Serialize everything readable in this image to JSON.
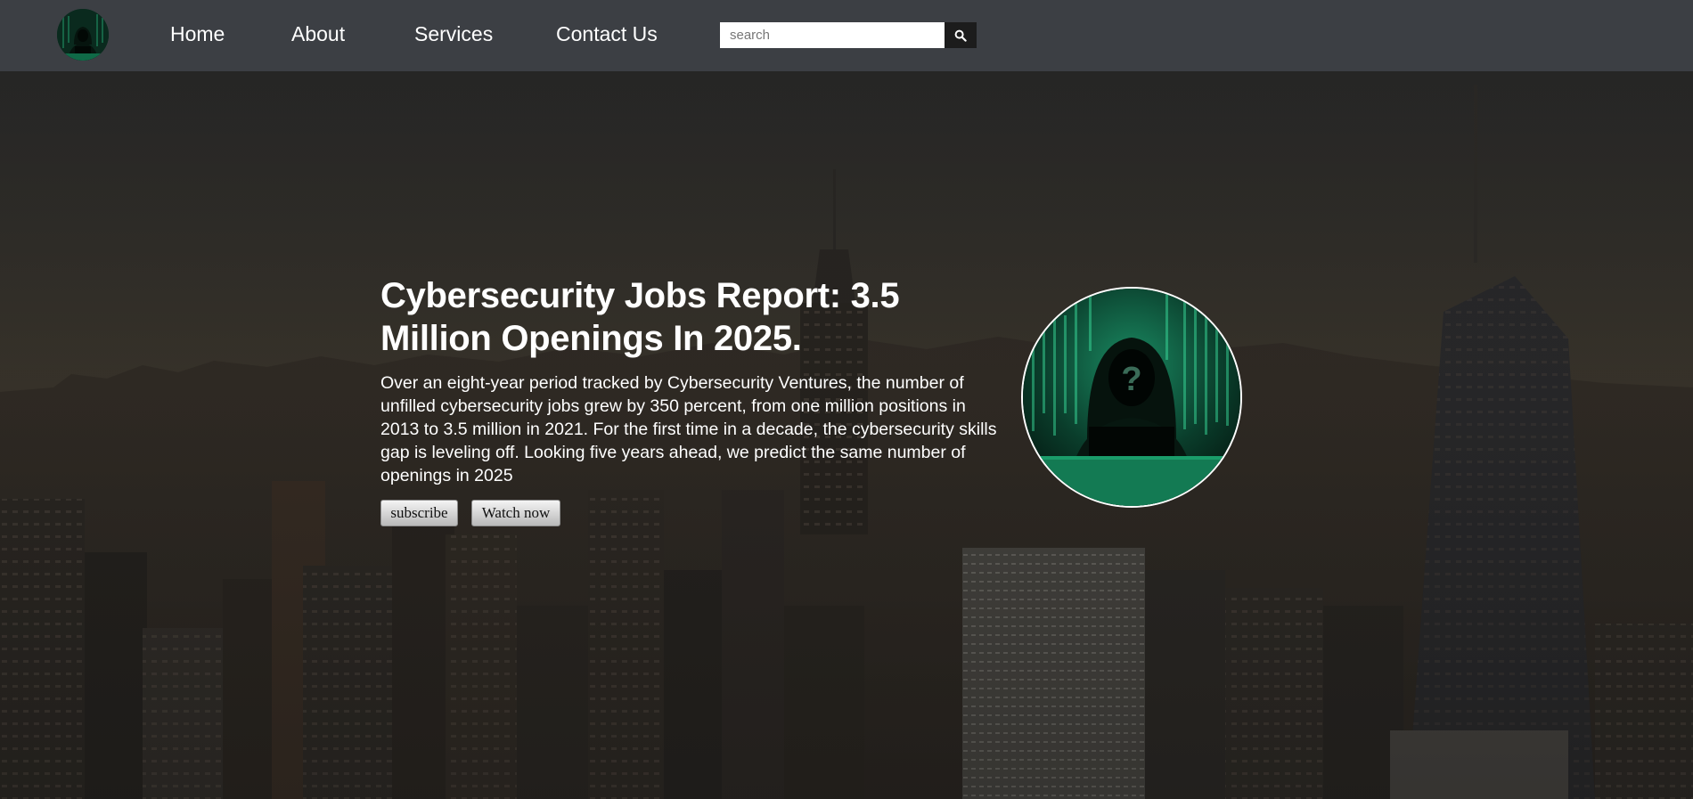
{
  "nav": {
    "logo_icon": "hooded-hacker-logo-icon",
    "links": [
      "Home",
      "About",
      "Services",
      "Contact Us"
    ],
    "search": {
      "placeholder": "search",
      "value": "",
      "button_icon": "search-icon"
    }
  },
  "hero": {
    "title": "Cybersecurity Jobs Report: 3.5 Million Openings In 2025.",
    "body": "Over an eight-year period tracked by Cybersecurity Ventures, the number of unfilled cybersecurity jobs grew by 350 percent, from one million positions in 2013 to 3.5 million in 2021. For the first time in a decade, the cybersecurity skills gap is leveling off. Looking five years ahead, we predict the same number of openings in 2025",
    "buttons": {
      "subscribe": "subscribe",
      "watch": "Watch now"
    },
    "image_icon": "hooded-hacker-image",
    "background": "city-skyline-background"
  },
  "colors": {
    "header_bg": "#3c3f44",
    "accent_green": "#1ea878",
    "text": "#ffffff"
  }
}
